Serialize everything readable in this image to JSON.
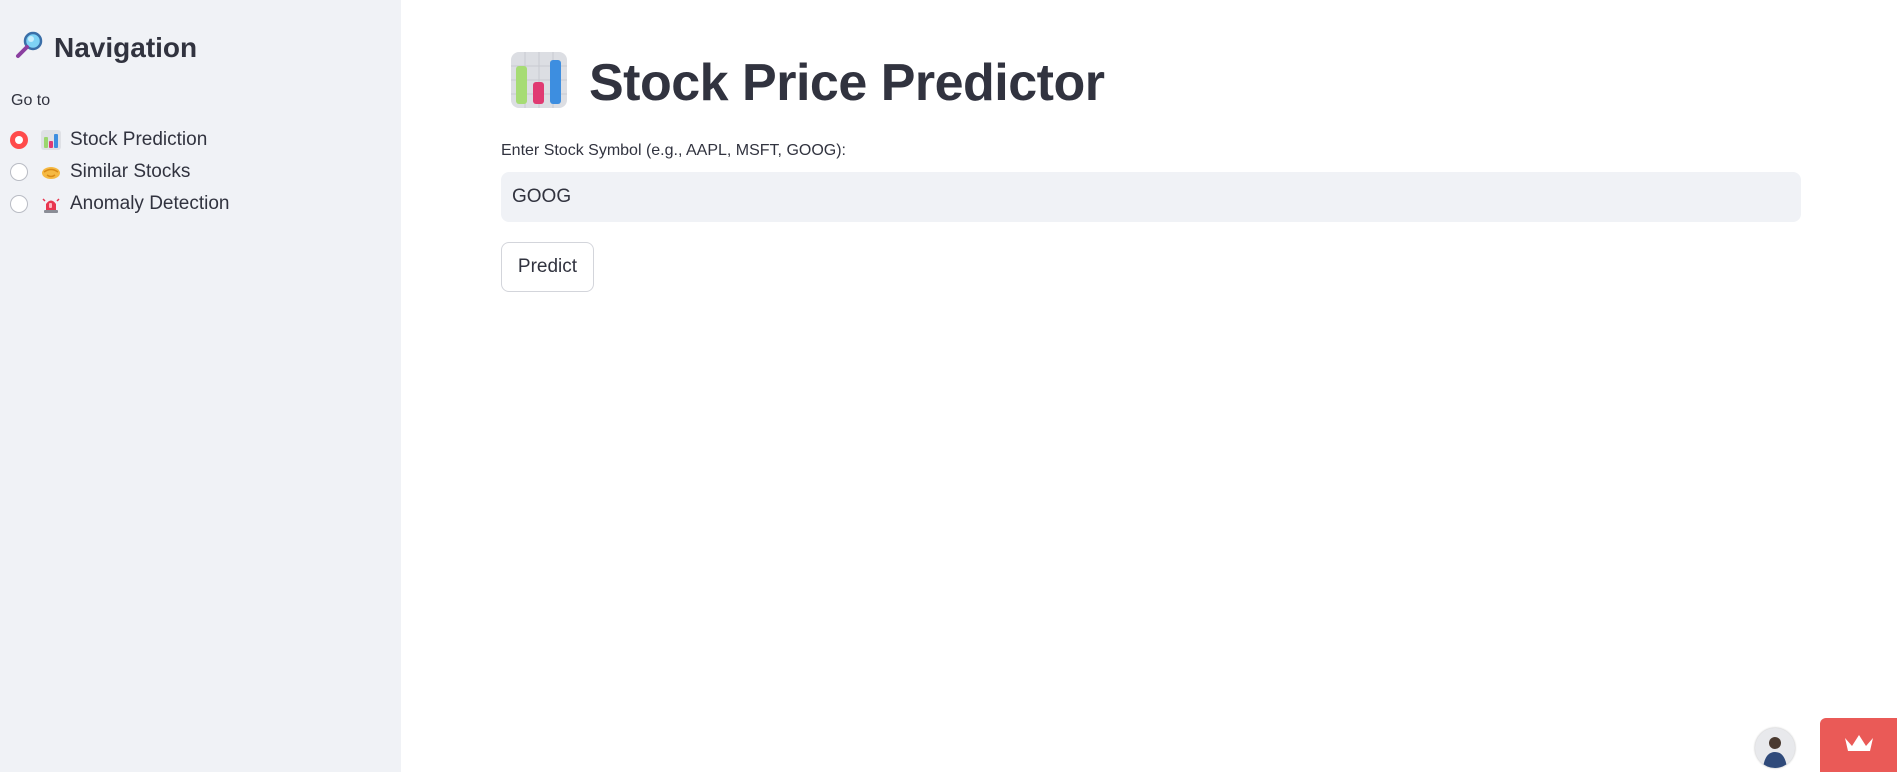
{
  "sidebar": {
    "title": "Navigation",
    "title_icon": "magnifying-glass-icon",
    "goto_label": "Go to",
    "options": [
      {
        "label": "Stock Prediction",
        "icon": "bar-chart-icon",
        "selected": true
      },
      {
        "label": "Similar Stocks",
        "icon": "handshake-icon",
        "selected": false
      },
      {
        "label": "Anomaly Detection",
        "icon": "siren-icon",
        "selected": false
      }
    ]
  },
  "main": {
    "title": "Stock Price Predictor",
    "title_icon": "bar-chart-icon",
    "input": {
      "label": "Enter Stock Symbol (e.g., AAPL, MSFT, GOOG):",
      "value": "GOOG"
    },
    "predict_label": "Predict"
  },
  "footer": {
    "avatar_icon": "user-avatar",
    "badge_icon": "crown-icon"
  },
  "colors": {
    "accent": "#ff4b4b",
    "sidebar_bg": "#f0f2f6",
    "text": "#31333f",
    "badge": "#ea5a57"
  }
}
